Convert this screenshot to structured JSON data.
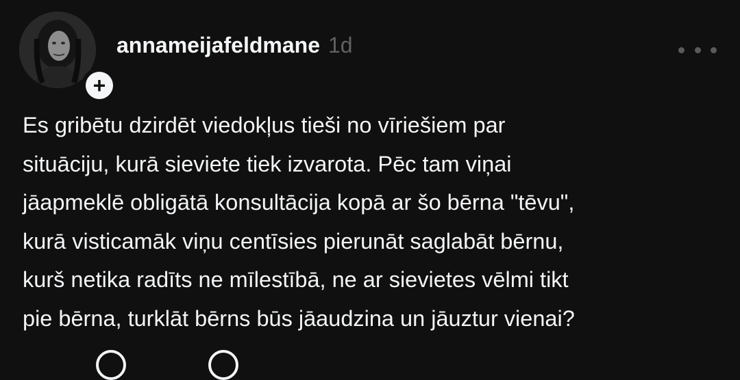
{
  "post": {
    "username": "annameijafeldmane",
    "timestamp": "1d",
    "avatar_icon": "profile-photo",
    "follow_icon": "plus-icon",
    "follow_symbol": "+",
    "more_icon": "more-horizontal-icon",
    "body_lines": [
      "Es gribētu dzirdēt viedokļus tieši no vīriešiem par",
      "situāciju, kurā sieviete tiek izvarota. Pēc tam viņai",
      "jāapmeklē obligātā konsultācija kopā ar šo bērna \"tēvu\",",
      "kurā visticamāk viņu centīsies pierunāt saglabāt bērnu,",
      "kurš netika radīts ne mīlestībā, ne ar sievietes vēlmi tikt",
      "pie bērna, turklāt bērns būs jāaudzina un jāuztur vienai?"
    ]
  },
  "colors": {
    "background": "#101010",
    "text": "#f3f5f7",
    "muted": "#616161"
  }
}
